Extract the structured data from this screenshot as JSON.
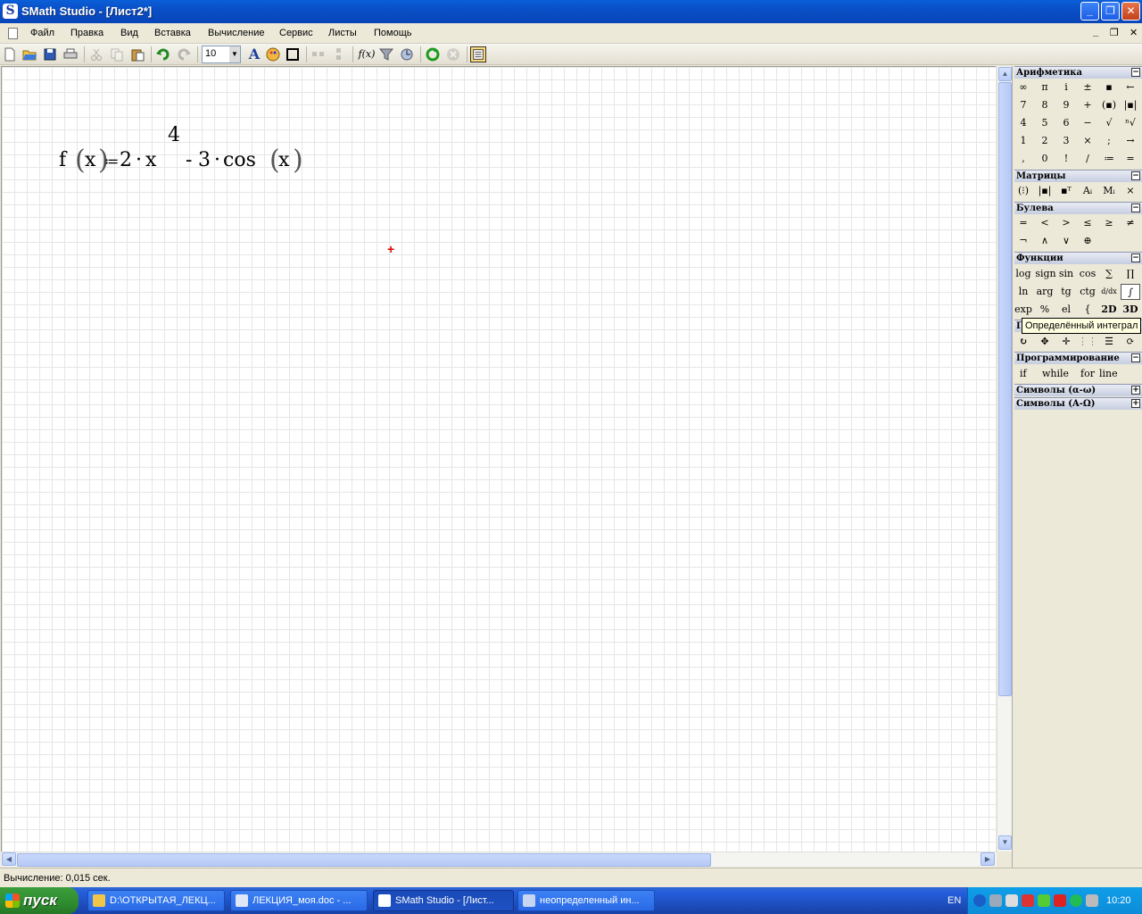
{
  "window": {
    "title": "SMath Studio - [Лист2*]",
    "app_glyph": "S"
  },
  "window_buttons": {
    "minimize": "_",
    "restore": "❐",
    "close": "✕"
  },
  "menu": {
    "items": [
      "Файл",
      "Правка",
      "Вид",
      "Вставка",
      "Вычисление",
      "Сервис",
      "Листы",
      "Помощь"
    ],
    "mdi": {
      "minimize": "_",
      "restore": "❐",
      "close": "✕"
    }
  },
  "toolbar": {
    "font_size": "10",
    "fx_label": "f(x)",
    "font_label": "A"
  },
  "worksheet": {
    "formula": {
      "f": "f",
      "open1": "(",
      "x1": "x",
      "close1": ")",
      "assign": "≔",
      "two": "2",
      "dot1": "·",
      "x2": "x",
      "power": "4",
      "minus": "-",
      "three": "3",
      "dot2": "·",
      "cos": "cos",
      "open2": "(",
      "x3": "x",
      "close2": ")"
    },
    "cursor": "+"
  },
  "panel": {
    "sections": {
      "arithmetic": {
        "title": "Арифметика",
        "toggle": "−",
        "rows": [
          [
            "∞",
            "π",
            "i",
            "±",
            "▪",
            "←"
          ],
          [
            "7",
            "8",
            "9",
            "+",
            "(▪)",
            "|▪|"
          ],
          [
            "4",
            "5",
            "6",
            "−",
            "√",
            "ⁿ√"
          ],
          [
            "1",
            "2",
            "3",
            "×",
            ";",
            "→"
          ],
          [
            ",",
            "0",
            "!",
            "/",
            "≔",
            "="
          ]
        ]
      },
      "matrices": {
        "title": "Матрицы",
        "toggle": "−",
        "row": [
          "(⁝)",
          "|▪|",
          "▪ᵀ",
          "Aᵢ",
          "Mᵢ",
          "×"
        ]
      },
      "boolean": {
        "title": "Булева",
        "toggle": "−",
        "rows": [
          [
            "=",
            "<",
            ">",
            "≤",
            "≥",
            "≠"
          ],
          [
            "¬",
            "∧",
            "∨",
            "⊕"
          ]
        ]
      },
      "functions": {
        "title": "Функции",
        "toggle": "−",
        "rows": [
          [
            "log",
            "sign",
            "sin",
            "cos",
            "∑",
            "∏"
          ],
          [
            "ln",
            "arg",
            "tg",
            "ctg",
            "d/dx",
            "∫"
          ],
          [
            "exp",
            "%",
            "el",
            "{",
            "2D",
            "3D"
          ]
        ]
      },
      "graphics": {
        "title": "Г",
        "toggle": "−",
        "row": [
          "↻",
          "✥",
          "✛",
          "⋮⋮",
          "☰",
          "⟳"
        ]
      },
      "programming": {
        "title": "Программирование",
        "toggle": "−",
        "row": [
          "if",
          "while",
          "for",
          "line"
        ]
      },
      "symbols_lower": {
        "title": "Символы (α-ω)",
        "toggle": "+"
      },
      "symbols_upper": {
        "title": "Символы (Α-Ω)",
        "toggle": "+"
      }
    },
    "tooltip": "Определённый интеграл"
  },
  "status": {
    "text": "Вычисление: 0,015 сек."
  },
  "taskbar": {
    "start": "пуск",
    "tasks": [
      "D:\\ОТКРЫТАЯ_ЛЕКЦ...",
      "ЛЕКЦИЯ_моя.doc - ...",
      "SMath Studio - [Лист...",
      "неопределенный ин..."
    ],
    "lang": "EN",
    "clock": "10:20"
  },
  "colors": {
    "titlebar": "#0a4fc6",
    "taskbar": "#245edb",
    "start": "#2f8c2f",
    "tray": "#0f9ee9",
    "tooltip": "#ffffe1"
  }
}
